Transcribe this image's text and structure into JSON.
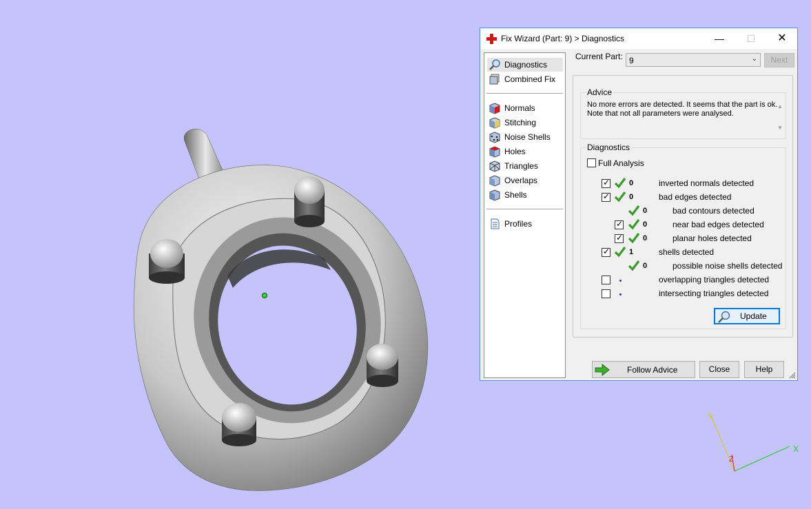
{
  "colors": {
    "background": "#c4c4fb",
    "accent": "#0078d7",
    "check_green": "#3a9a2c",
    "x_axis": "#22cc22",
    "y_axis": "#e0c020",
    "z_axis": "#dd2222"
  },
  "viewport": {
    "axes": {
      "x": "X",
      "y": "Y",
      "z": "Z"
    }
  },
  "window": {
    "title": "Fix Wizard (Part: 9) > Diagnostics",
    "icon": "red-cross-icon",
    "controls": {
      "minimize": "—",
      "maximize": "☐",
      "close": "✕"
    }
  },
  "nav": {
    "top": [
      {
        "label": "Diagnostics",
        "icon": "magnifier-icon",
        "selected": true
      },
      {
        "label": "Combined Fix",
        "icon": "combined-fix-icon"
      }
    ],
    "tools": [
      {
        "label": "Normals",
        "icon": "normals-cube-icon"
      },
      {
        "label": "Stitching",
        "icon": "stitching-cube-icon"
      },
      {
        "label": "Noise Shells",
        "icon": "noise-shells-icon"
      },
      {
        "label": "Holes",
        "icon": "holes-cube-icon"
      },
      {
        "label": "Triangles",
        "icon": "triangles-cube-icon"
      },
      {
        "label": "Overlaps",
        "icon": "overlaps-cube-icon"
      },
      {
        "label": "Shells",
        "icon": "shells-cube-icon"
      }
    ],
    "bottom": [
      {
        "label": "Profiles",
        "icon": "document-icon"
      }
    ]
  },
  "current_part": {
    "label": "Current Part:",
    "value": "9",
    "next_label": "Next"
  },
  "advice": {
    "title": "Advice",
    "text": "No more errors are detected. It seems that the part is ok. Note that not all parameters were analysed."
  },
  "diagnostics": {
    "title": "Diagnostics",
    "full_analysis": {
      "label": "Full Analysis",
      "checked": false
    },
    "rows": [
      {
        "checkbox": true,
        "checked": true,
        "status": "ok",
        "count": "0",
        "label": "inverted normals detected",
        "indent": 0
      },
      {
        "checkbox": true,
        "checked": true,
        "status": "ok",
        "count": "0",
        "label": "bad edges detected",
        "indent": 0
      },
      {
        "checkbox": false,
        "checked": false,
        "status": "ok",
        "count": "0",
        "label": "bad contours detected",
        "indent": 1
      },
      {
        "checkbox": true,
        "checked": true,
        "status": "ok",
        "count": "0",
        "label": "near bad edges detected",
        "indent": 1
      },
      {
        "checkbox": true,
        "checked": true,
        "status": "ok",
        "count": "0",
        "label": "planar holes detected",
        "indent": 1
      },
      {
        "checkbox": true,
        "checked": true,
        "status": "ok",
        "count": "1",
        "label": "shells detected",
        "indent": 0
      },
      {
        "checkbox": false,
        "checked": false,
        "status": "ok",
        "count": "0",
        "label": "possible noise shells detected",
        "indent": 1
      },
      {
        "checkbox": true,
        "checked": false,
        "status": "none",
        "count": "",
        "label": "overlapping triangles detected",
        "indent": 0
      },
      {
        "checkbox": true,
        "checked": false,
        "status": "none",
        "count": "",
        "label": "intersecting triangles detected",
        "indent": 0
      }
    ],
    "update_label": "Update"
  },
  "footer": {
    "follow_advice": "Follow Advice",
    "close": "Close",
    "help": "Help"
  }
}
